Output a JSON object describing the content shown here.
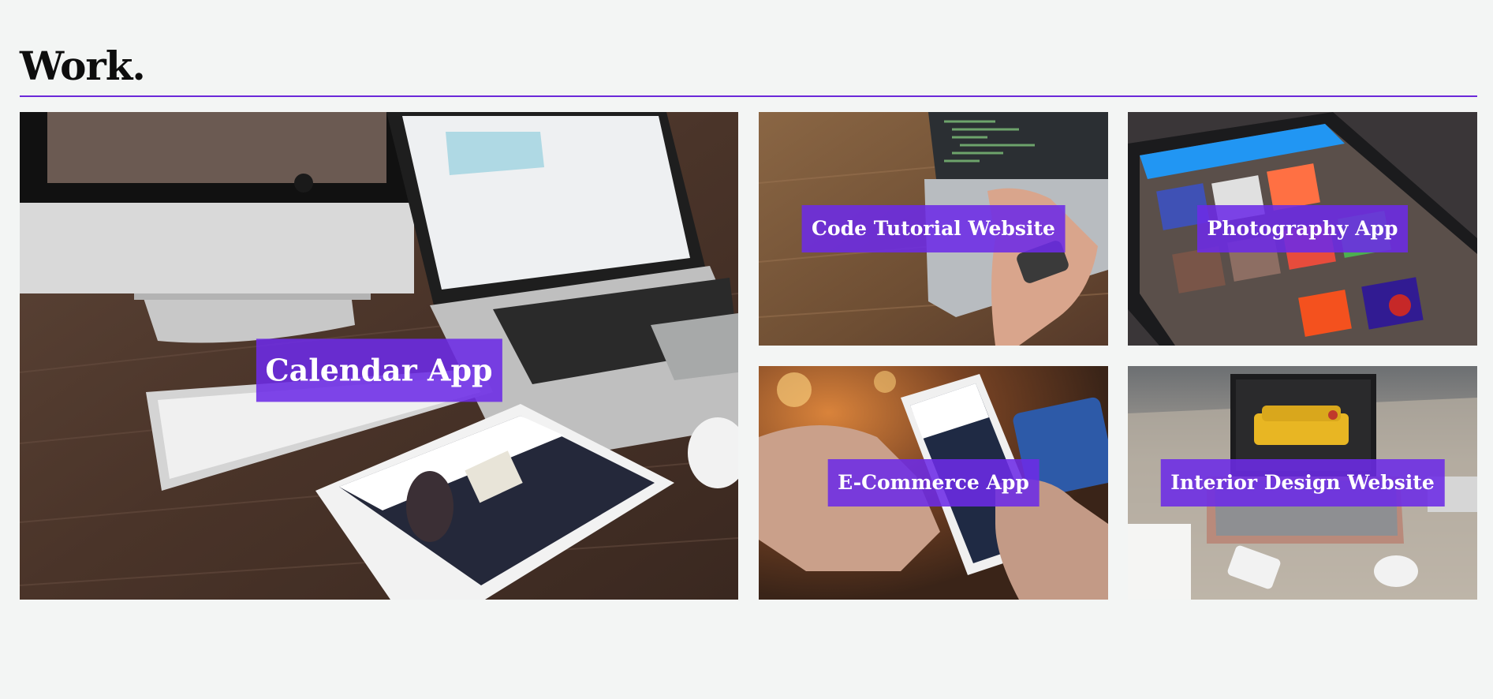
{
  "section": {
    "title": "Work."
  },
  "projects": [
    {
      "title": "Calendar App",
      "image": "desk with iMac, MacBook, keyboard and iPad"
    },
    {
      "title": "Code Tutorial Website",
      "image": "hands typing code on laptop"
    },
    {
      "title": "Photography App",
      "image": "tablet showing photo collections"
    },
    {
      "title": "E-Commerce App",
      "image": "phone shopping cart with credit card"
    },
    {
      "title": "Interior Design Website",
      "image": "laptop showing yellow sofa product page"
    }
  ],
  "colors": {
    "accent": "#6b28d9",
    "label_bg": "#6c2be6",
    "background": "#f3f5f4"
  }
}
